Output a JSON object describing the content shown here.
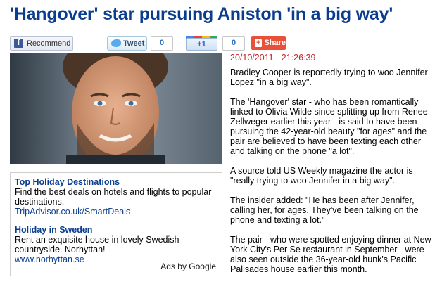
{
  "headline": "'Hangover' star pursuing Aniston 'in a big way'",
  "share": {
    "facebook_label": "Recommend",
    "tweet_label": "Tweet",
    "tweet_count": "0",
    "plusone_label": "+1",
    "plusone_count": "0",
    "share_label": "Share",
    "colors": {
      "facebook": "#3b5998",
      "twitter": "#55acee",
      "share": "#e8503a",
      "headline": "#0b3d8f",
      "timestamp": "#c2272d"
    }
  },
  "article": {
    "timestamp": "20/10/2011 - 21:26:39",
    "paragraphs": [
      "Bradley Cooper is reportedly trying to woo Jennifer Lopez \"in a big way\".",
      "The 'Hangover' star - who has been romantically linked to Olivia Wilde since splitting up from Renee Zellweger earlier this year - is said to have been pursuing the 42-year-old beauty \"for ages\" and the pair are believed to have been texting each other and talking on the phone \"a lot\".",
      "A source told US Weekly magazine the actor is \"really trying to woo Jennifer in a big way\".",
      "The insider added: \"He has been after Jennifer, calling her, for ages. They've been talking on the phone and texting a lot.\"",
      "The pair - who were spotted enjoying dinner at New York City's Per Se restaurant in September - were also seen outside the 36-year-old hunk's Pacific Palisades house earlier this month."
    ]
  },
  "ads": {
    "items": [
      {
        "title": "Top Holiday Destinations",
        "description": "Find the best deals on hotels and flights to popular destinations.",
        "url": "TripAdvisor.co.uk/SmartDeals"
      },
      {
        "title": "Holiday in Sweden",
        "description": "Rent an exquisite house in lovely Swedish countryside. Norhyttan!",
        "url": "www.norhyttan.se"
      }
    ],
    "footer": "Ads by Google"
  }
}
